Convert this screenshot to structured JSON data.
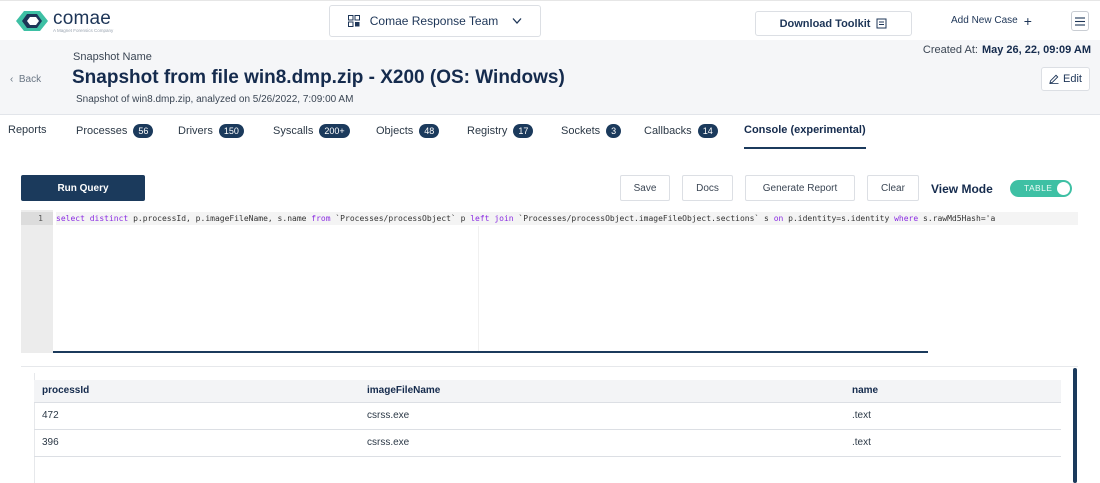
{
  "brand": {
    "name": "comae",
    "tagline": "A Magnet Forensics Company"
  },
  "topbar": {
    "team": "Comae Response Team",
    "download_label": "Download Toolkit",
    "add_case_label": "Add New Case"
  },
  "header": {
    "back_label": "Back",
    "snapshot_label": "Snapshot Name",
    "title": "Snapshot from file win8.dmp.zip - X200 (OS: Windows)",
    "subtitle": "Snapshot of win8.dmp.zip, analyzed on 5/26/2022, 7:09:00 AM",
    "created_label": "Created At:",
    "created_value": "May 26, 22, 09:09 AM",
    "edit_label": "Edit"
  },
  "tabs": [
    {
      "label": "Reports",
      "badge": null
    },
    {
      "label": "Processes",
      "badge": "56"
    },
    {
      "label": "Drivers",
      "badge": "150"
    },
    {
      "label": "Syscalls",
      "badge": "200+"
    },
    {
      "label": "Objects",
      "badge": "48"
    },
    {
      "label": "Registry",
      "badge": "17"
    },
    {
      "label": "Sockets",
      "badge": "3"
    },
    {
      "label": "Callbacks",
      "badge": "14"
    },
    {
      "label": "Console (experimental)",
      "badge": null,
      "active": true
    }
  ],
  "toolbar": {
    "run_label": "Run Query",
    "save_label": "Save",
    "docs_label": "Docs",
    "report_label": "Generate Report",
    "clear_label": "Clear",
    "view_mode_label": "View Mode",
    "toggle_label": "TABLE"
  },
  "editor": {
    "line_number": "1",
    "tokens": [
      {
        "t": "select distinct",
        "k": true
      },
      {
        "t": " p.processId, p.imageFileName, s.name ",
        "k": false
      },
      {
        "t": "from",
        "k": true
      },
      {
        "t": " `Processes/processObject` p ",
        "k": false
      },
      {
        "t": "left join",
        "k": true
      },
      {
        "t": " `Processes/processObject.imageFileObject.sections` s ",
        "k": false
      },
      {
        "t": "on",
        "k": true
      },
      {
        "t": " p.identity=s.identity ",
        "k": false
      },
      {
        "t": "where",
        "k": true
      },
      {
        "t": " s.rawMd5Hash='a",
        "k": false
      }
    ]
  },
  "results": {
    "columns": [
      "processId",
      "imageFileName",
      "name"
    ],
    "rows": [
      [
        "472",
        "csrss.exe",
        ".text"
      ],
      [
        "396",
        "csrss.exe",
        ".text"
      ]
    ]
  },
  "colors": {
    "primary": "#1b3a5c",
    "accent": "#3ec0a4"
  }
}
